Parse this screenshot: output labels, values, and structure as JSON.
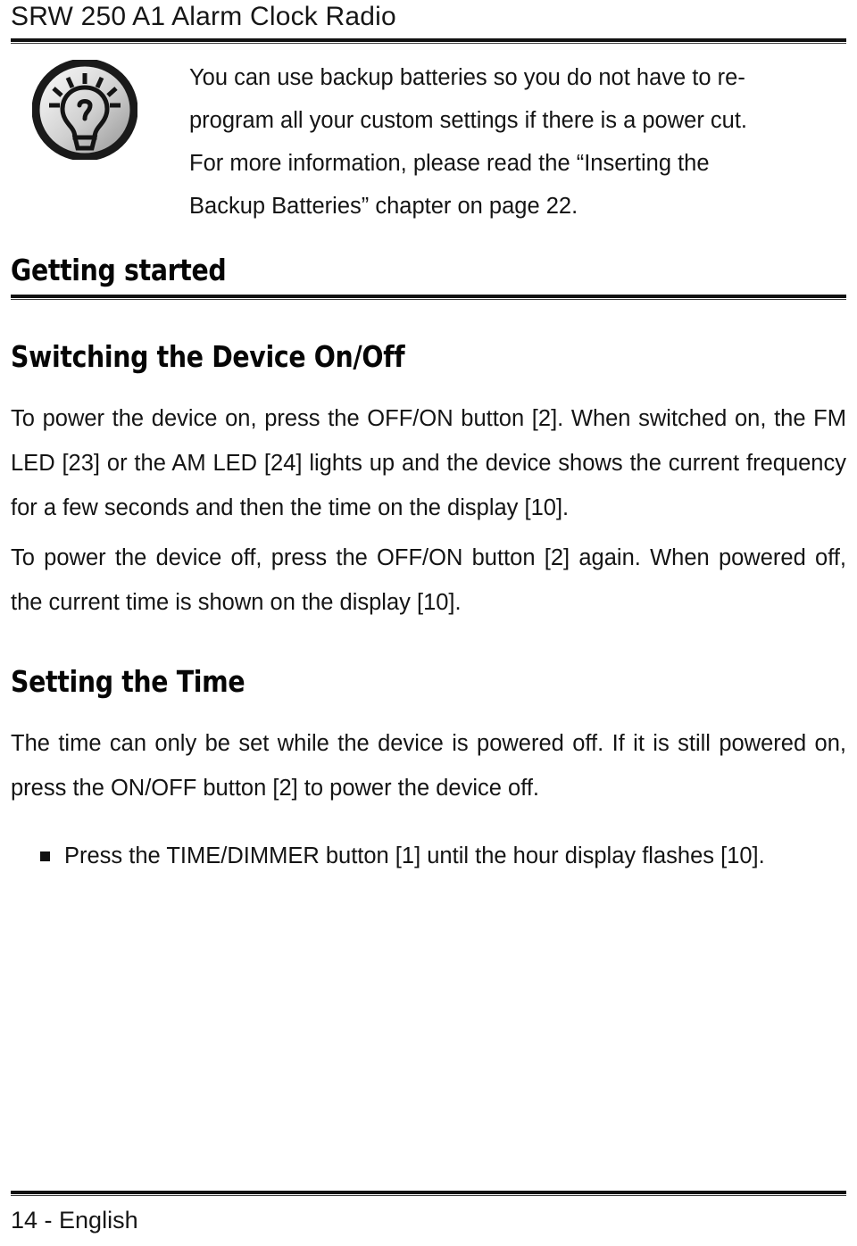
{
  "document": {
    "running_header": "SRW 250 A1 Alarm Clock Radio",
    "footer": "14 - English"
  },
  "tip": {
    "icon": "lightbulb-tip-icon",
    "paragraphs": [
      "You can use backup batteries so you do not have to re-program all your custom settings if there is a power cut. For more information, please read the “Inserting the Backup Batteries” chapter on page 22."
    ],
    "line_1": "You can use backup batteries so you do not have to re-",
    "line_2": "program all your custom settings if there is a power cut.",
    "line_3": "For more information, please read the “Inserting the",
    "line_4": "Backup Batteries” chapter on page 22."
  },
  "sections": {
    "chapter_heading": "Getting started",
    "heading_switching": "Switching the Device On/Off",
    "para_power_on": "To power the device on, press the OFF/ON button [2]. When switched on, the FM LED [23] or the AM LED [24] lights up and the device shows the current frequency for a few seconds and then the time on the display [10].",
    "para_power_off": "To power the device off, press the OFF/ON button [2] again. When powered off, the current time is shown on the display [10].",
    "heading_setting_time": "Setting the Time",
    "para_setting_time": "The time can only be set while the device is powered off. If it is still powered on, press the ON/OFF button [2] to power the device off.",
    "bullet_items": [
      "Press the TIME/DIMMER button [1] until the hour display flashes [10]."
    ],
    "bullet_item_1": "Press the TIME/DIMMER button [1] until the hour display flashes [10]."
  },
  "colors": {
    "text": "#141414",
    "rule": "#111111",
    "page_background": "#ffffff",
    "icon_ring": "#1a1a1a",
    "icon_fill_light": "#f2f2f2",
    "icon_fill_dark": "#9a9a9a"
  }
}
